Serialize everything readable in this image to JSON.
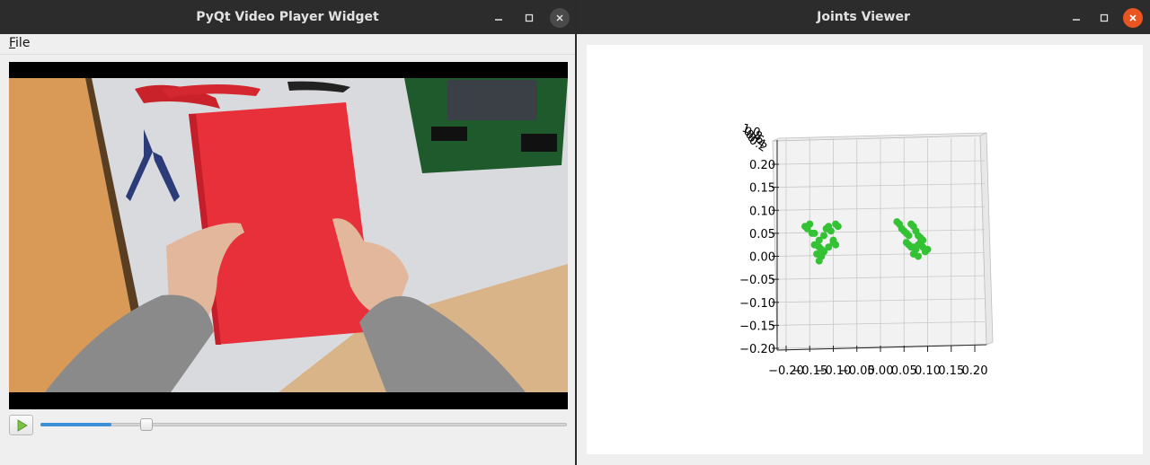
{
  "left_window": {
    "title": "PyQt Video Player Widget",
    "menu": {
      "file_label": "File"
    },
    "player": {
      "progress_fraction": 0.135
    }
  },
  "right_window": {
    "title": "Joints Viewer"
  },
  "colors": {
    "titlebar": "#2c2c2c",
    "close_button": "#e95420",
    "window_bg": "#efefef",
    "scatter_points": "#33c233",
    "slider_fill": "#3d8fd8",
    "notebook_red": "#e8303b"
  },
  "icons": [
    "minimize-icon",
    "maximize-icon",
    "close-icon",
    "play-icon"
  ],
  "chart_data": {
    "type": "scatter",
    "projection": "3d",
    "title": "",
    "grid": true,
    "xlim": [
      -0.2,
      0.2
    ],
    "ylim": [
      -0.2,
      0.2
    ],
    "xticks": [
      "−0.20",
      "−0.15",
      "−0.10",
      "−0.05",
      "0.00",
      "0.05",
      "0.10",
      "0.15",
      "0.20"
    ],
    "yticks": [
      "0.20",
      "0.15",
      "0.10",
      "0.05",
      "0.00",
      "−0.05",
      "−0.10",
      "−0.15",
      "−0.20"
    ],
    "zticks": [
      "1.0",
      "0.8",
      "0.6",
      "0.4",
      "0.2"
    ],
    "series": [
      {
        "x": [
          -0.16,
          -0.155,
          -0.15,
          -0.145,
          -0.14,
          -0.13,
          -0.12,
          -0.115,
          -0.11,
          -0.105,
          -0.1,
          -0.1,
          -0.095,
          -0.09,
          -0.14,
          -0.13,
          -0.125,
          -0.12,
          -0.135,
          -0.125,
          -0.11,
          -0.095,
          -0.13
        ],
        "y": [
          0.065,
          0.06,
          0.07,
          0.05,
          0.05,
          0.035,
          0.045,
          0.06,
          0.065,
          0.055,
          0.035,
          0.03,
          0.07,
          0.065,
          0.025,
          0.02,
          0.015,
          0.01,
          0.005,
          0.0,
          0.02,
          0.025,
          -0.01
        ],
        "color": "#33c233"
      },
      {
        "x": [
          0.035,
          0.04,
          0.045,
          0.05,
          0.055,
          0.06,
          0.065,
          0.07,
          0.075,
          0.08,
          0.085,
          0.09,
          0.055,
          0.06,
          0.065,
          0.07,
          0.075,
          0.08,
          0.085,
          0.09,
          0.095,
          0.1,
          0.07,
          0.08
        ],
        "y": [
          0.075,
          0.07,
          0.06,
          0.055,
          0.05,
          0.045,
          0.07,
          0.065,
          0.055,
          0.045,
          0.04,
          0.035,
          0.03,
          0.025,
          0.02,
          0.02,
          0.015,
          0.025,
          0.03,
          0.02,
          0.01,
          0.015,
          0.005,
          0.0
        ],
        "color": "#33c233"
      }
    ]
  }
}
